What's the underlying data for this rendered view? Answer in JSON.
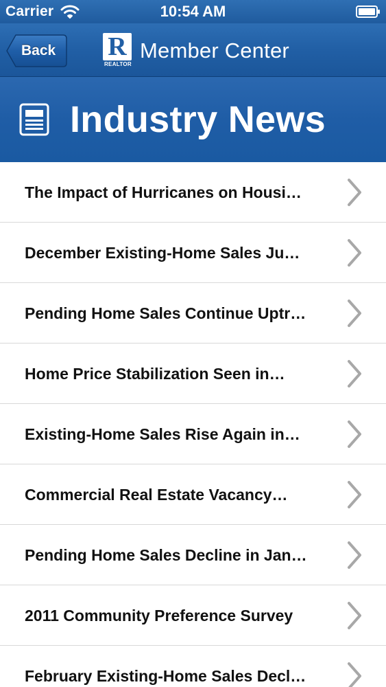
{
  "status_bar": {
    "carrier": "Carrier",
    "time": "10:54 AM",
    "icons": [
      "wifi-icon",
      "battery-icon"
    ]
  },
  "nav_bar": {
    "back_label": "Back",
    "logo_letter": "R",
    "logo_word": "REALTOR",
    "title": "Member Center"
  },
  "header": {
    "icon": "newspaper-icon",
    "title": "Industry News"
  },
  "news_items": [
    "The Impact of Hurricanes on Housi…",
    "December Existing-Home Sales Ju…",
    "Pending Home Sales Continue Uptr…",
    "Home Price Stabilization Seen in…",
    "Existing-Home Sales Rise Again in…",
    "Commercial Real Estate Vacancy…",
    "Pending Home Sales Decline in Jan…",
    "2011 Community Preference Survey",
    "February Existing-Home Sales Decl…"
  ],
  "colors": {
    "nav_blue": "#215fa5",
    "header_blue": "#1f5da6",
    "chevron_gray": "#a8a8a8",
    "item_text": "#111111"
  }
}
